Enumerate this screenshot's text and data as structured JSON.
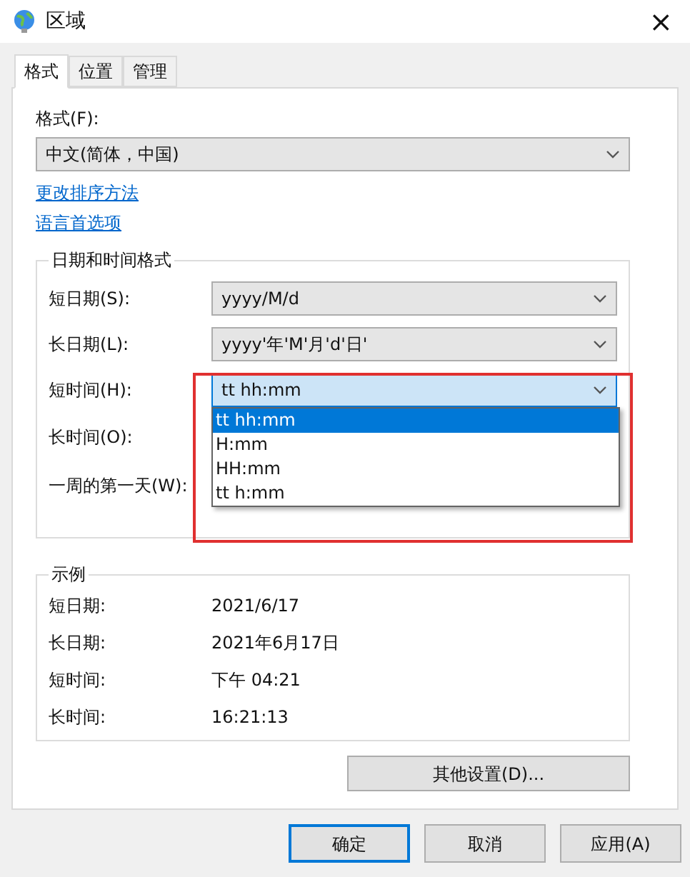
{
  "window": {
    "title": "区域",
    "close": "×"
  },
  "tabs": [
    {
      "label": "格式",
      "selected": true
    },
    {
      "label": "位置",
      "selected": false
    },
    {
      "label": "管理",
      "selected": false
    }
  ],
  "format": {
    "label": "格式(F):",
    "value": "中文(简体，中国)"
  },
  "links": [
    "更改排序方法",
    "语言首选项"
  ],
  "date_time_formats": {
    "title": "日期和时间格式",
    "fields": [
      {
        "label": "短日期(S):",
        "value": "yyyy/M/d",
        "focused": false
      },
      {
        "label": "长日期(L):",
        "value": "yyyy'年'M'月'd'日'",
        "focused": false
      },
      {
        "label": "短时间(H):",
        "value": "tt hh:mm",
        "focused": true,
        "options": [
          {
            "label": "tt hh:mm",
            "selected": true
          },
          {
            "label": "H:mm",
            "selected": false
          },
          {
            "label": "HH:mm",
            "selected": false
          },
          {
            "label": "tt h:mm",
            "selected": false
          }
        ]
      },
      {
        "label": "长时间(O):"
      },
      {
        "label": "一周的第一天(W):"
      }
    ]
  },
  "examples": {
    "title": "示例",
    "rows": [
      {
        "label": "短日期:",
        "value": "2021/6/17"
      },
      {
        "label": "长日期:",
        "value": "2021年6月17日"
      },
      {
        "label": "短时间:",
        "value": "下午 04:21"
      },
      {
        "label": "长时间:",
        "value": "16:21:13"
      }
    ]
  },
  "additional_settings": "其他设置(D)...",
  "buttons": [
    {
      "label": "确定",
      "default": true
    },
    {
      "label": "取消",
      "default": false
    },
    {
      "label": "应用(A)",
      "default": false
    }
  ]
}
